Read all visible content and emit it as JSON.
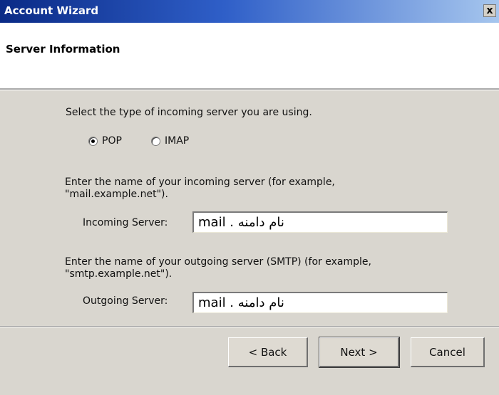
{
  "window": {
    "title": "Account Wizard",
    "close_label": "x"
  },
  "header": {
    "heading": "Server Information"
  },
  "incoming_type": {
    "prompt": "Select the type of incoming server you are using.",
    "options": [
      {
        "label": "POP",
        "selected": true
      },
      {
        "label": "IMAP",
        "selected": false
      }
    ]
  },
  "incoming": {
    "instruction_line1": "Enter the name of your incoming server (for example,",
    "instruction_line2": "\"mail.example.net\").",
    "label": "Incoming Server:",
    "value": "mail . نام دامنه"
  },
  "outgoing": {
    "instruction_line1": "Enter the name of your outgoing server (SMTP) (for example,",
    "instruction_line2": "\"smtp.example.net\").",
    "label": "Outgoing Server:",
    "value": "mail . نام دامنه"
  },
  "buttons": {
    "back": "< Back",
    "next": "Next >",
    "cancel": "Cancel"
  }
}
